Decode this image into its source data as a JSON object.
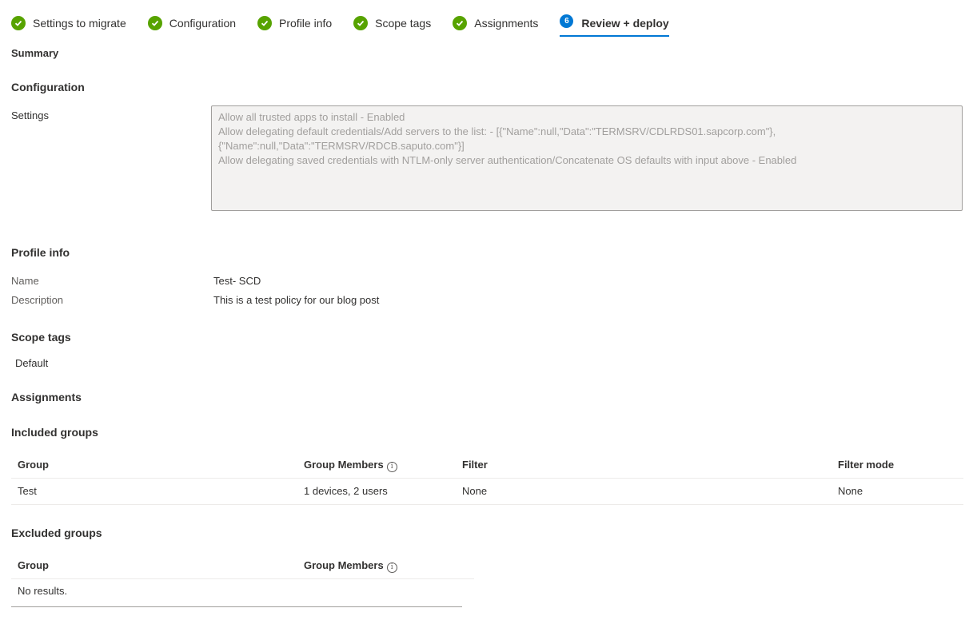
{
  "wizard": {
    "steps": [
      {
        "label": "Settings to migrate"
      },
      {
        "label": "Configuration"
      },
      {
        "label": "Profile info"
      },
      {
        "label": "Scope tags"
      },
      {
        "label": "Assignments"
      },
      {
        "label": "Review + deploy",
        "number": "6"
      }
    ]
  },
  "summary": {
    "heading": "Summary"
  },
  "configuration": {
    "heading": "Configuration",
    "settings_label": "Settings",
    "settings_lines": [
      "Allow all trusted apps to install - Enabled",
      "Allow delegating default credentials/Add servers to the list: - [{\"Name\":null,\"Data\":\"TERMSRV/CDLRDS01.sapcorp.com\"},",
      "{\"Name\":null,\"Data\":\"TERMSRV/RDCB.saputo.com\"}]",
      "Allow delegating saved credentials with NTLM-only server authentication/Concatenate OS defaults with input above - Enabled"
    ]
  },
  "profile_info": {
    "heading": "Profile info",
    "name_label": "Name",
    "name_value": "Test- SCD",
    "description_label": "Description",
    "description_value": "This is a test policy for our blog post"
  },
  "scope_tags": {
    "heading": "Scope tags",
    "value": "Default"
  },
  "assignments": {
    "heading": "Assignments",
    "included": {
      "heading": "Included groups",
      "columns": [
        "Group",
        "Group Members",
        "Filter",
        "Filter mode"
      ],
      "rows": [
        [
          "Test",
          "1 devices, 2 users",
          "None",
          "None"
        ]
      ]
    },
    "excluded": {
      "heading": "Excluded groups",
      "columns": [
        "Group",
        "Group Members"
      ],
      "empty_text": "No results."
    }
  },
  "icons": {
    "completed_step": "checkmark-circle-icon",
    "info": "info-icon"
  },
  "colors": {
    "success": "#57a300",
    "accent": "#0078d4"
  }
}
